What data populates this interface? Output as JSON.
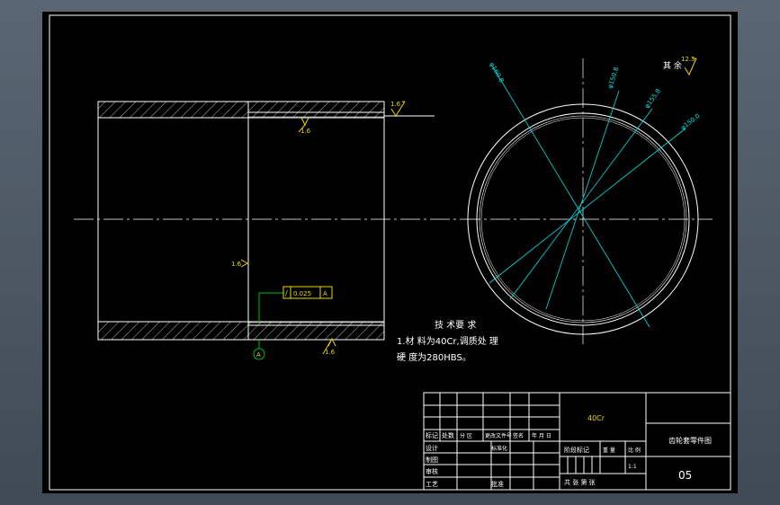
{
  "drawing": {
    "roughness_right": "1.6",
    "roughness_top_inner": "1.6",
    "roughness_bottom_inner": "1.6",
    "roughness_left": "1.6",
    "roughness_other": "12.5",
    "other_label": "其 余",
    "tolerance_symbol": "/",
    "tolerance_value": "0.025",
    "tolerance_datum": "A",
    "datum_label": "A",
    "diameters": [
      "φ160.8",
      "φ150.8",
      "φ155.8",
      "φ150.0"
    ],
    "tech_title": "技 术要 求",
    "tech_line1": "1.材 料为40Cr,调质处 理",
    "tech_line2": "硬 度为280HBS。"
  },
  "title_block": {
    "material": "40Cr",
    "part_name": "齿轮套零件图",
    "drawing_no": "05",
    "scale": "1:1",
    "row_mark": "标记",
    "row_count": "处数",
    "row_zone": "分 区",
    "row_change_doc": "更改文件号",
    "row_sign": "签名",
    "row_date": "年 月 日",
    "design": "设计",
    "standardize": "标准化",
    "drafting": "制图",
    "review": "审核",
    "process": "工艺",
    "approve": "批准",
    "stage_mark": "阶段标记",
    "weight": "重 量",
    "ratio": "比 例",
    "sheets": "共   张 第   张"
  }
}
